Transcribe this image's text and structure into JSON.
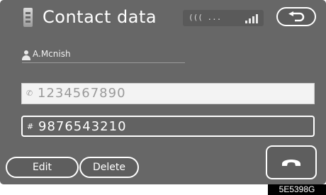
{
  "header": {
    "title": "Contact data",
    "status_text": "((( ...",
    "back_icon": "back-arrow-icon"
  },
  "contact": {
    "name": "A.Mcnish",
    "selected_number_icon": "✆",
    "selected_number": "1234567890",
    "second_number_icon": "#",
    "second_number": "9876543210"
  },
  "actions": {
    "edit_label": "Edit",
    "delete_label": "Delete",
    "call_icon": "phone-handset-icon"
  },
  "figure_code": "5E5398G",
  "colors": {
    "screen_bg": "#676767",
    "text": "#ffffff",
    "selected_field_bg": "#f3f3f3"
  }
}
